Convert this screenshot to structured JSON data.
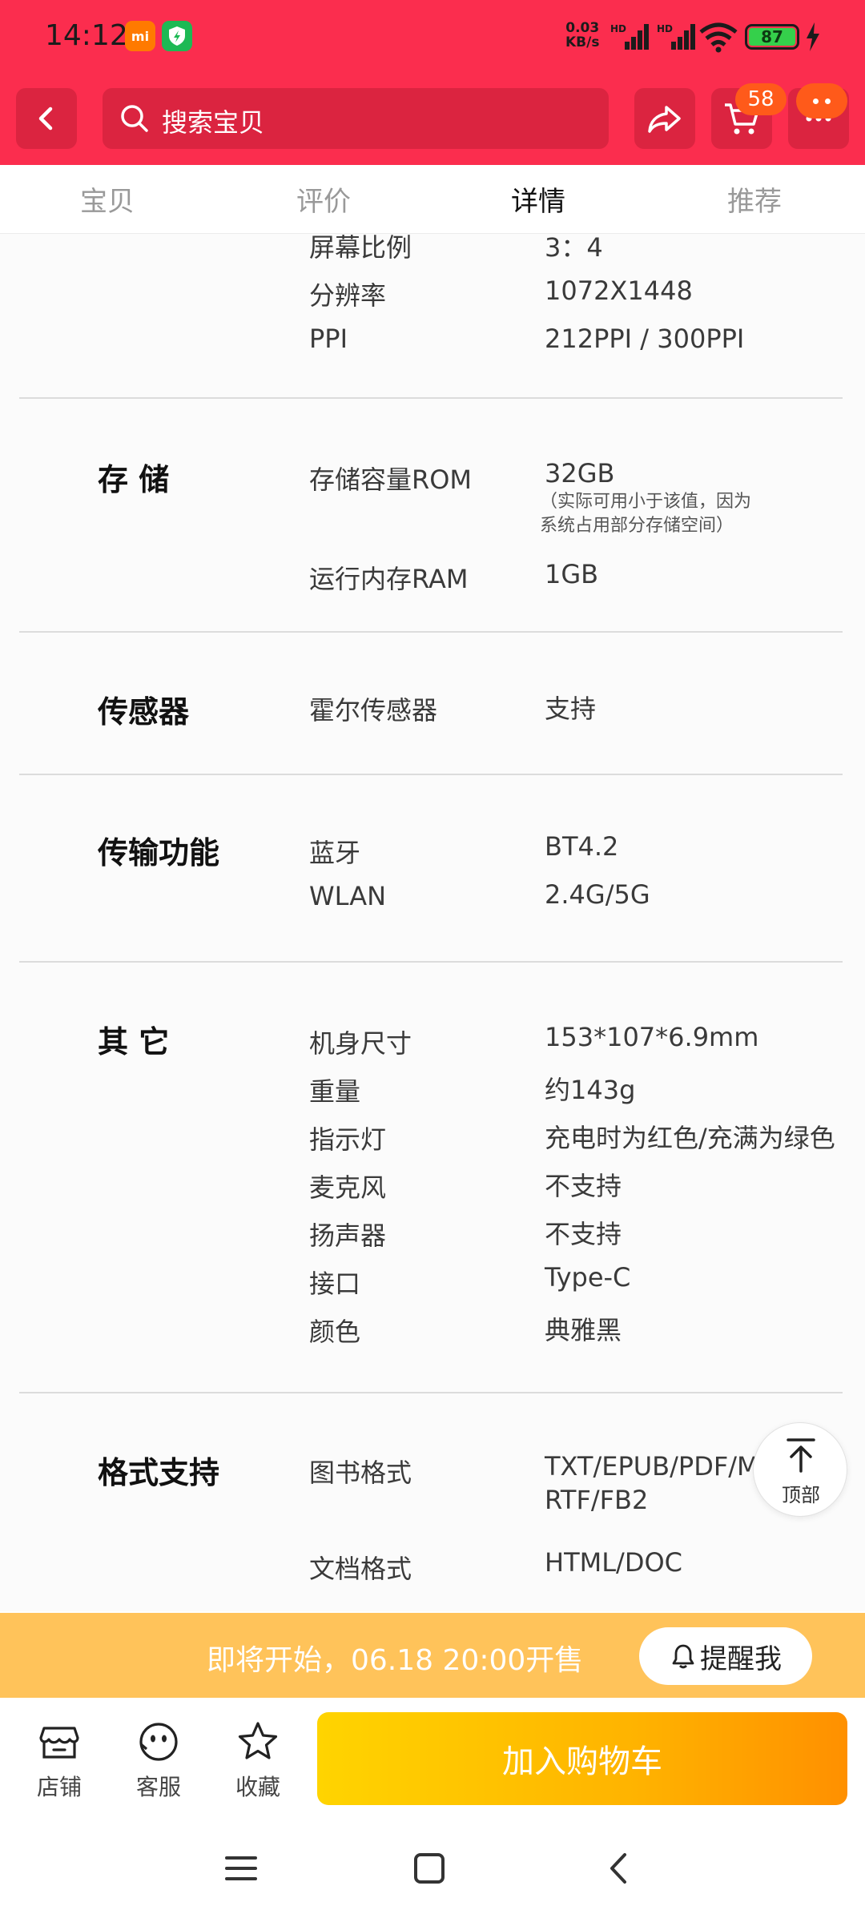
{
  "status_bar": {
    "time": "14:12",
    "mi_label": "mi",
    "net_speed_value": "0.03",
    "net_speed_unit": "KB/s",
    "signal_1_label": "HD",
    "signal_2_label": "HD",
    "battery": "87"
  },
  "nav": {
    "search_placeholder": "搜索宝贝",
    "cart_count": "58"
  },
  "tabs": [
    "宝贝",
    "评价",
    "详情",
    "推荐"
  ],
  "active_tab": "详情",
  "specs": {
    "display": {
      "rows": [
        {
          "label": "屏幕比例",
          "value": "3：4"
        },
        {
          "label": "分辨率",
          "value": "1072X1448"
        },
        {
          "label": "PPI",
          "value": "212PPI / 300PPI"
        }
      ]
    },
    "storage": {
      "title": "存 储",
      "rows": [
        {
          "label": "存储容量ROM",
          "value": "32GB"
        },
        {
          "label": "运行内存RAM",
          "value": "1GB"
        }
      ],
      "note_line1": "（实际可用小于该值，因为",
      "note_line2": "系统占用部分存储空间）"
    },
    "sensor": {
      "title": "传感器",
      "rows": [
        {
          "label": "霍尔传感器",
          "value": "支持"
        }
      ]
    },
    "transfer": {
      "title": "传输功能",
      "rows": [
        {
          "label": "蓝牙",
          "value": "BT4.2"
        },
        {
          "label": "WLAN",
          "value": "2.4G/5G"
        }
      ]
    },
    "other": {
      "title": "其 它",
      "rows": [
        {
          "label": "机身尺寸",
          "value": "153*107*6.9mm"
        },
        {
          "label": "重量",
          "value": "约143g"
        },
        {
          "label": "指示灯",
          "value": "充电时为红色/充满为绿色"
        },
        {
          "label": "麦克风",
          "value": "不支持"
        },
        {
          "label": "扬声器",
          "value": "不支持"
        },
        {
          "label": "接口",
          "value": "Type-C"
        },
        {
          "label": "颜色",
          "value": "典雅黑"
        }
      ]
    },
    "format": {
      "title": "格式支持",
      "rows": [
        {
          "label": "图书格式",
          "value": "TXT/EPUB/PDF/MOBI/",
          "value_line2": "RTF/FB2"
        },
        {
          "label": "文档格式",
          "value": "HTML/DOC"
        }
      ]
    }
  },
  "back_to_top_label": "顶部",
  "sale_banner": {
    "text": "即将开始，06.18 20:00开售",
    "remind_label": "提醒我"
  },
  "bottom_bar": {
    "shop_label": "店铺",
    "service_label": "客服",
    "favorite_label": "收藏",
    "add_to_cart_label": "加入购物车"
  },
  "colors": {
    "header_red": "#fb2d4e",
    "banner_yellow": "#ffc35a",
    "cart_gradient_start": "#ffd400",
    "cart_gradient_end": "#ff9000"
  },
  "icons": [
    "back-icon",
    "search-icon",
    "share-icon",
    "cart-icon",
    "more-icon",
    "bell-icon",
    "shop-icon",
    "service-icon",
    "star-icon",
    "arrow-up-icon"
  ]
}
